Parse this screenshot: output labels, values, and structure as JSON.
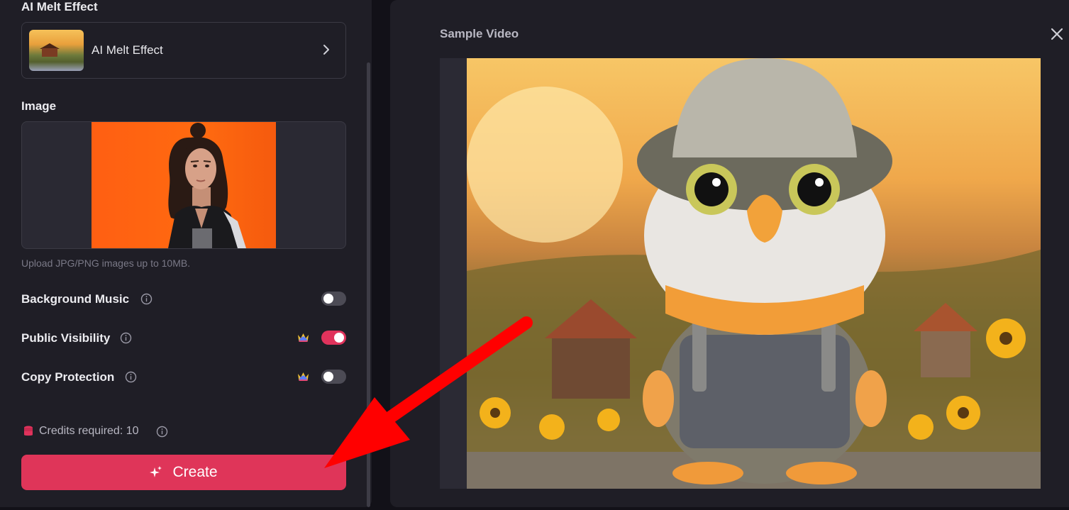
{
  "left_panel": {
    "effect_section_title": "AI Melt Effect",
    "effect_card_label": "AI Melt Effect",
    "image_section_title": "Image",
    "upload_hint": "Upload JPG/PNG images up to 10MB.",
    "options": [
      {
        "label": "Background Music",
        "premium": false,
        "enabled": false
      },
      {
        "label": "Public Visibility",
        "premium": true,
        "enabled": true
      },
      {
        "label": "Copy Protection",
        "premium": true,
        "enabled": false
      }
    ],
    "credits_text": "Credits required: 10",
    "create_label": "Create"
  },
  "right_panel": {
    "title": "Sample Video"
  },
  "colors": {
    "accent": "#df3559",
    "panel_bg": "#1f1e26",
    "page_bg": "#121118",
    "annotation_arrow": "#ff0000"
  }
}
